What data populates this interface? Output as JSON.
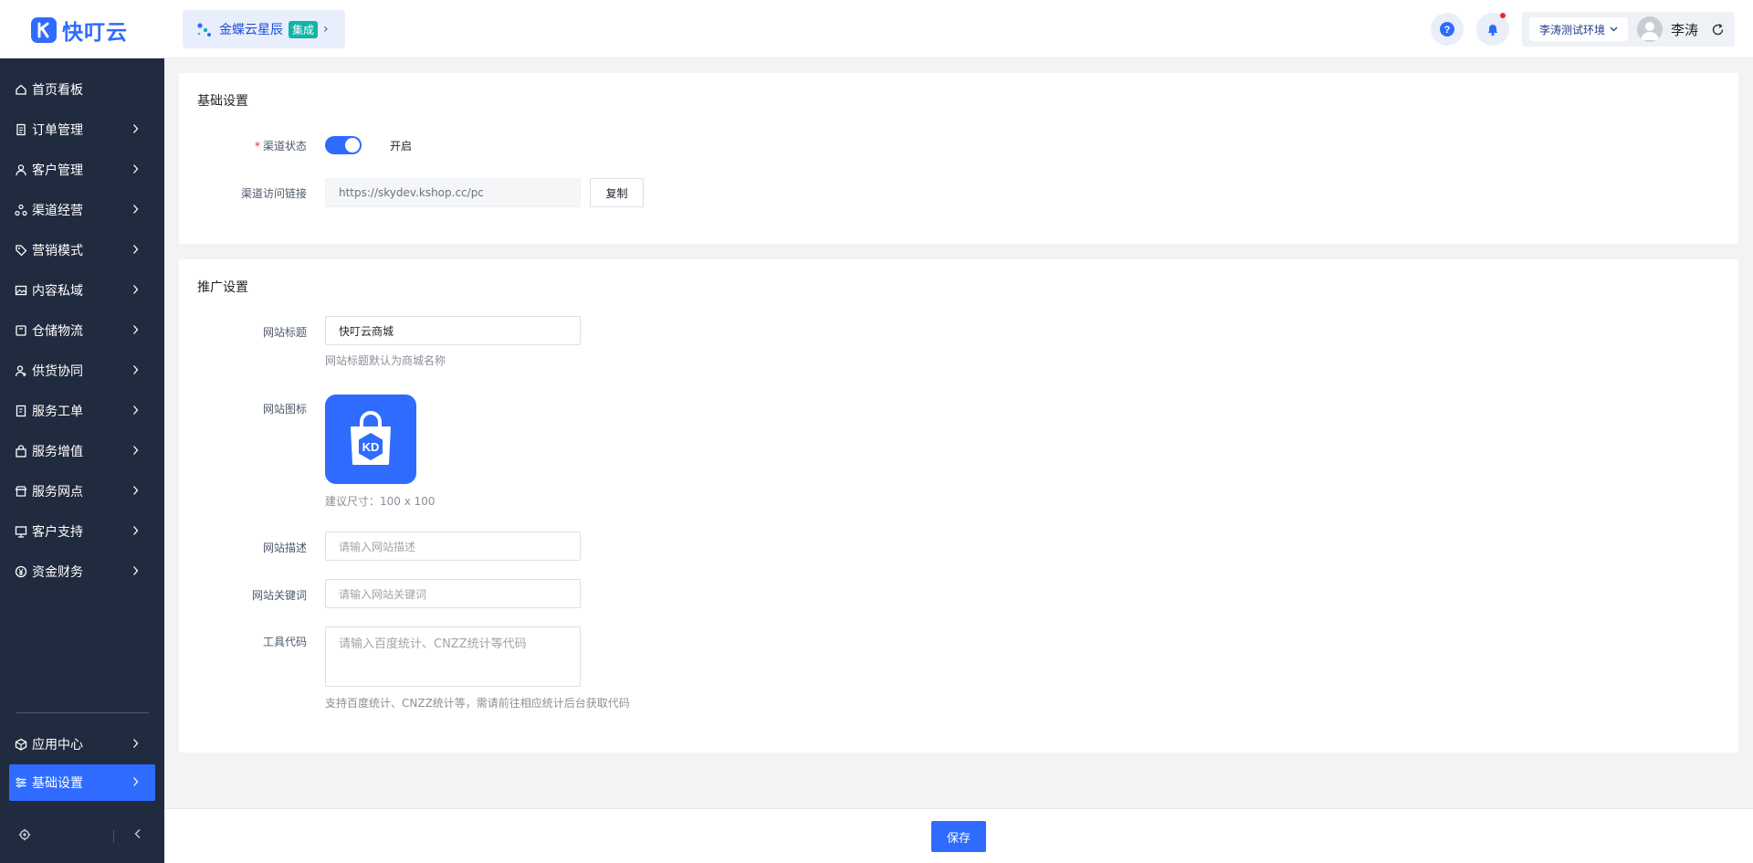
{
  "app": {
    "logo_text": "快叮云"
  },
  "header": {
    "product": {
      "name": "金蝶云星辰",
      "tag": "集成"
    },
    "environment": "李涛测试环境",
    "user_name": "李涛"
  },
  "sidebar": {
    "items": [
      {
        "label": "首页看板",
        "icon": "home-icon",
        "has_children": false
      },
      {
        "label": "订单管理",
        "icon": "order-icon",
        "has_children": true
      },
      {
        "label": "客户管理",
        "icon": "user-icon",
        "has_children": true
      },
      {
        "label": "渠道经营",
        "icon": "channel-icon",
        "has_children": true
      },
      {
        "label": "营销模式",
        "icon": "tag-icon",
        "has_children": true
      },
      {
        "label": "内容私域",
        "icon": "image-icon",
        "has_children": true
      },
      {
        "label": "仓储物流",
        "icon": "box-icon",
        "has_children": true
      },
      {
        "label": "供货协同",
        "icon": "supplier-icon",
        "has_children": true
      },
      {
        "label": "服务工单",
        "icon": "ticket-icon",
        "has_children": true
      },
      {
        "label": "服务增值",
        "icon": "bag-icon",
        "has_children": true
      },
      {
        "label": "服务网点",
        "icon": "store-icon",
        "has_children": true
      },
      {
        "label": "客户支持",
        "icon": "support-icon",
        "has_children": true
      },
      {
        "label": "资金财务",
        "icon": "yuan-icon",
        "has_children": true
      }
    ],
    "bottom_items": [
      {
        "label": "应用中心",
        "icon": "cube-icon",
        "active": false
      },
      {
        "label": "基础设置",
        "icon": "settings-sliders-icon",
        "active": true
      }
    ]
  },
  "basic_settings": {
    "title": "基础设置",
    "channel_status_label": "渠道状态",
    "channel_status_on": true,
    "channel_status_text": "开启",
    "channel_link_label": "渠道访问链接",
    "channel_link_value": "https://skydev.kshop.cc/pc",
    "copy_label": "复制"
  },
  "promo_settings": {
    "title": "推广设置",
    "site_title_label": "网站标题",
    "site_title_value": "快叮云商城",
    "site_title_hint": "网站标题默认为商城名称",
    "site_icon_label": "网站图标",
    "site_icon_hint": "建议尺寸：100 x 100",
    "site_desc_label": "网站描述",
    "site_desc_placeholder": "请输入网站描述",
    "site_keywords_label": "网站关键词",
    "site_keywords_placeholder": "请输入网站关键词",
    "tool_code_label": "工具代码",
    "tool_code_placeholder": "请输入百度统计、CNZZ统计等代码",
    "tool_code_hint": "支持百度统计、CNZZ统计等，需请前往相应统计后台获取代码"
  },
  "footer": {
    "save_label": "保存"
  },
  "colors": {
    "primary": "#2f6bff",
    "sidebar_bg": "#212b3f",
    "page_bg": "#f2f3f5"
  }
}
